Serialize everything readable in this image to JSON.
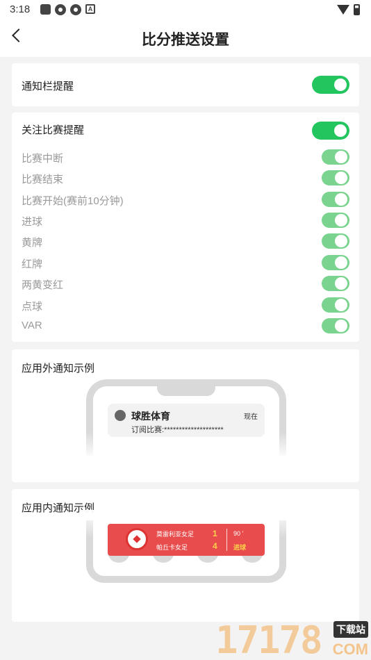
{
  "status_bar": {
    "time": "3:18"
  },
  "header": {
    "title": "比分推送设置"
  },
  "notification_bar": {
    "label": "通知栏提醒",
    "enabled": true
  },
  "follow": {
    "label": "关注比赛提醒",
    "enabled": true,
    "items": [
      {
        "label": "比赛中断",
        "enabled": true
      },
      {
        "label": "比赛结束",
        "enabled": true
      },
      {
        "label": "比赛开始(赛前10分钟)",
        "enabled": true
      },
      {
        "label": "进球",
        "enabled": true
      },
      {
        "label": "黄牌",
        "enabled": true
      },
      {
        "label": "红牌",
        "enabled": true
      },
      {
        "label": "两黄变红",
        "enabled": true
      },
      {
        "label": "点球",
        "enabled": true
      },
      {
        "label": "VAR",
        "enabled": true
      }
    ]
  },
  "outside_example": {
    "title": "应用外通知示例",
    "app_name": "球胜体育",
    "time": "现在",
    "text": "订阅比赛:********************"
  },
  "inside_example": {
    "title": "应用内通知示例",
    "home_team": "莫雷利亚女足",
    "away_team": "帕丘卡女足",
    "home_score": "1",
    "away_score": "4",
    "minute": "90 '",
    "event": "进球"
  },
  "watermark": {
    "number": "17178",
    "tag": "下载站",
    "domain": "COM"
  },
  "colors": {
    "toggle_on": "#22c55e",
    "toggle_sub": "#7ad48f",
    "banner": "#e84c4c"
  }
}
